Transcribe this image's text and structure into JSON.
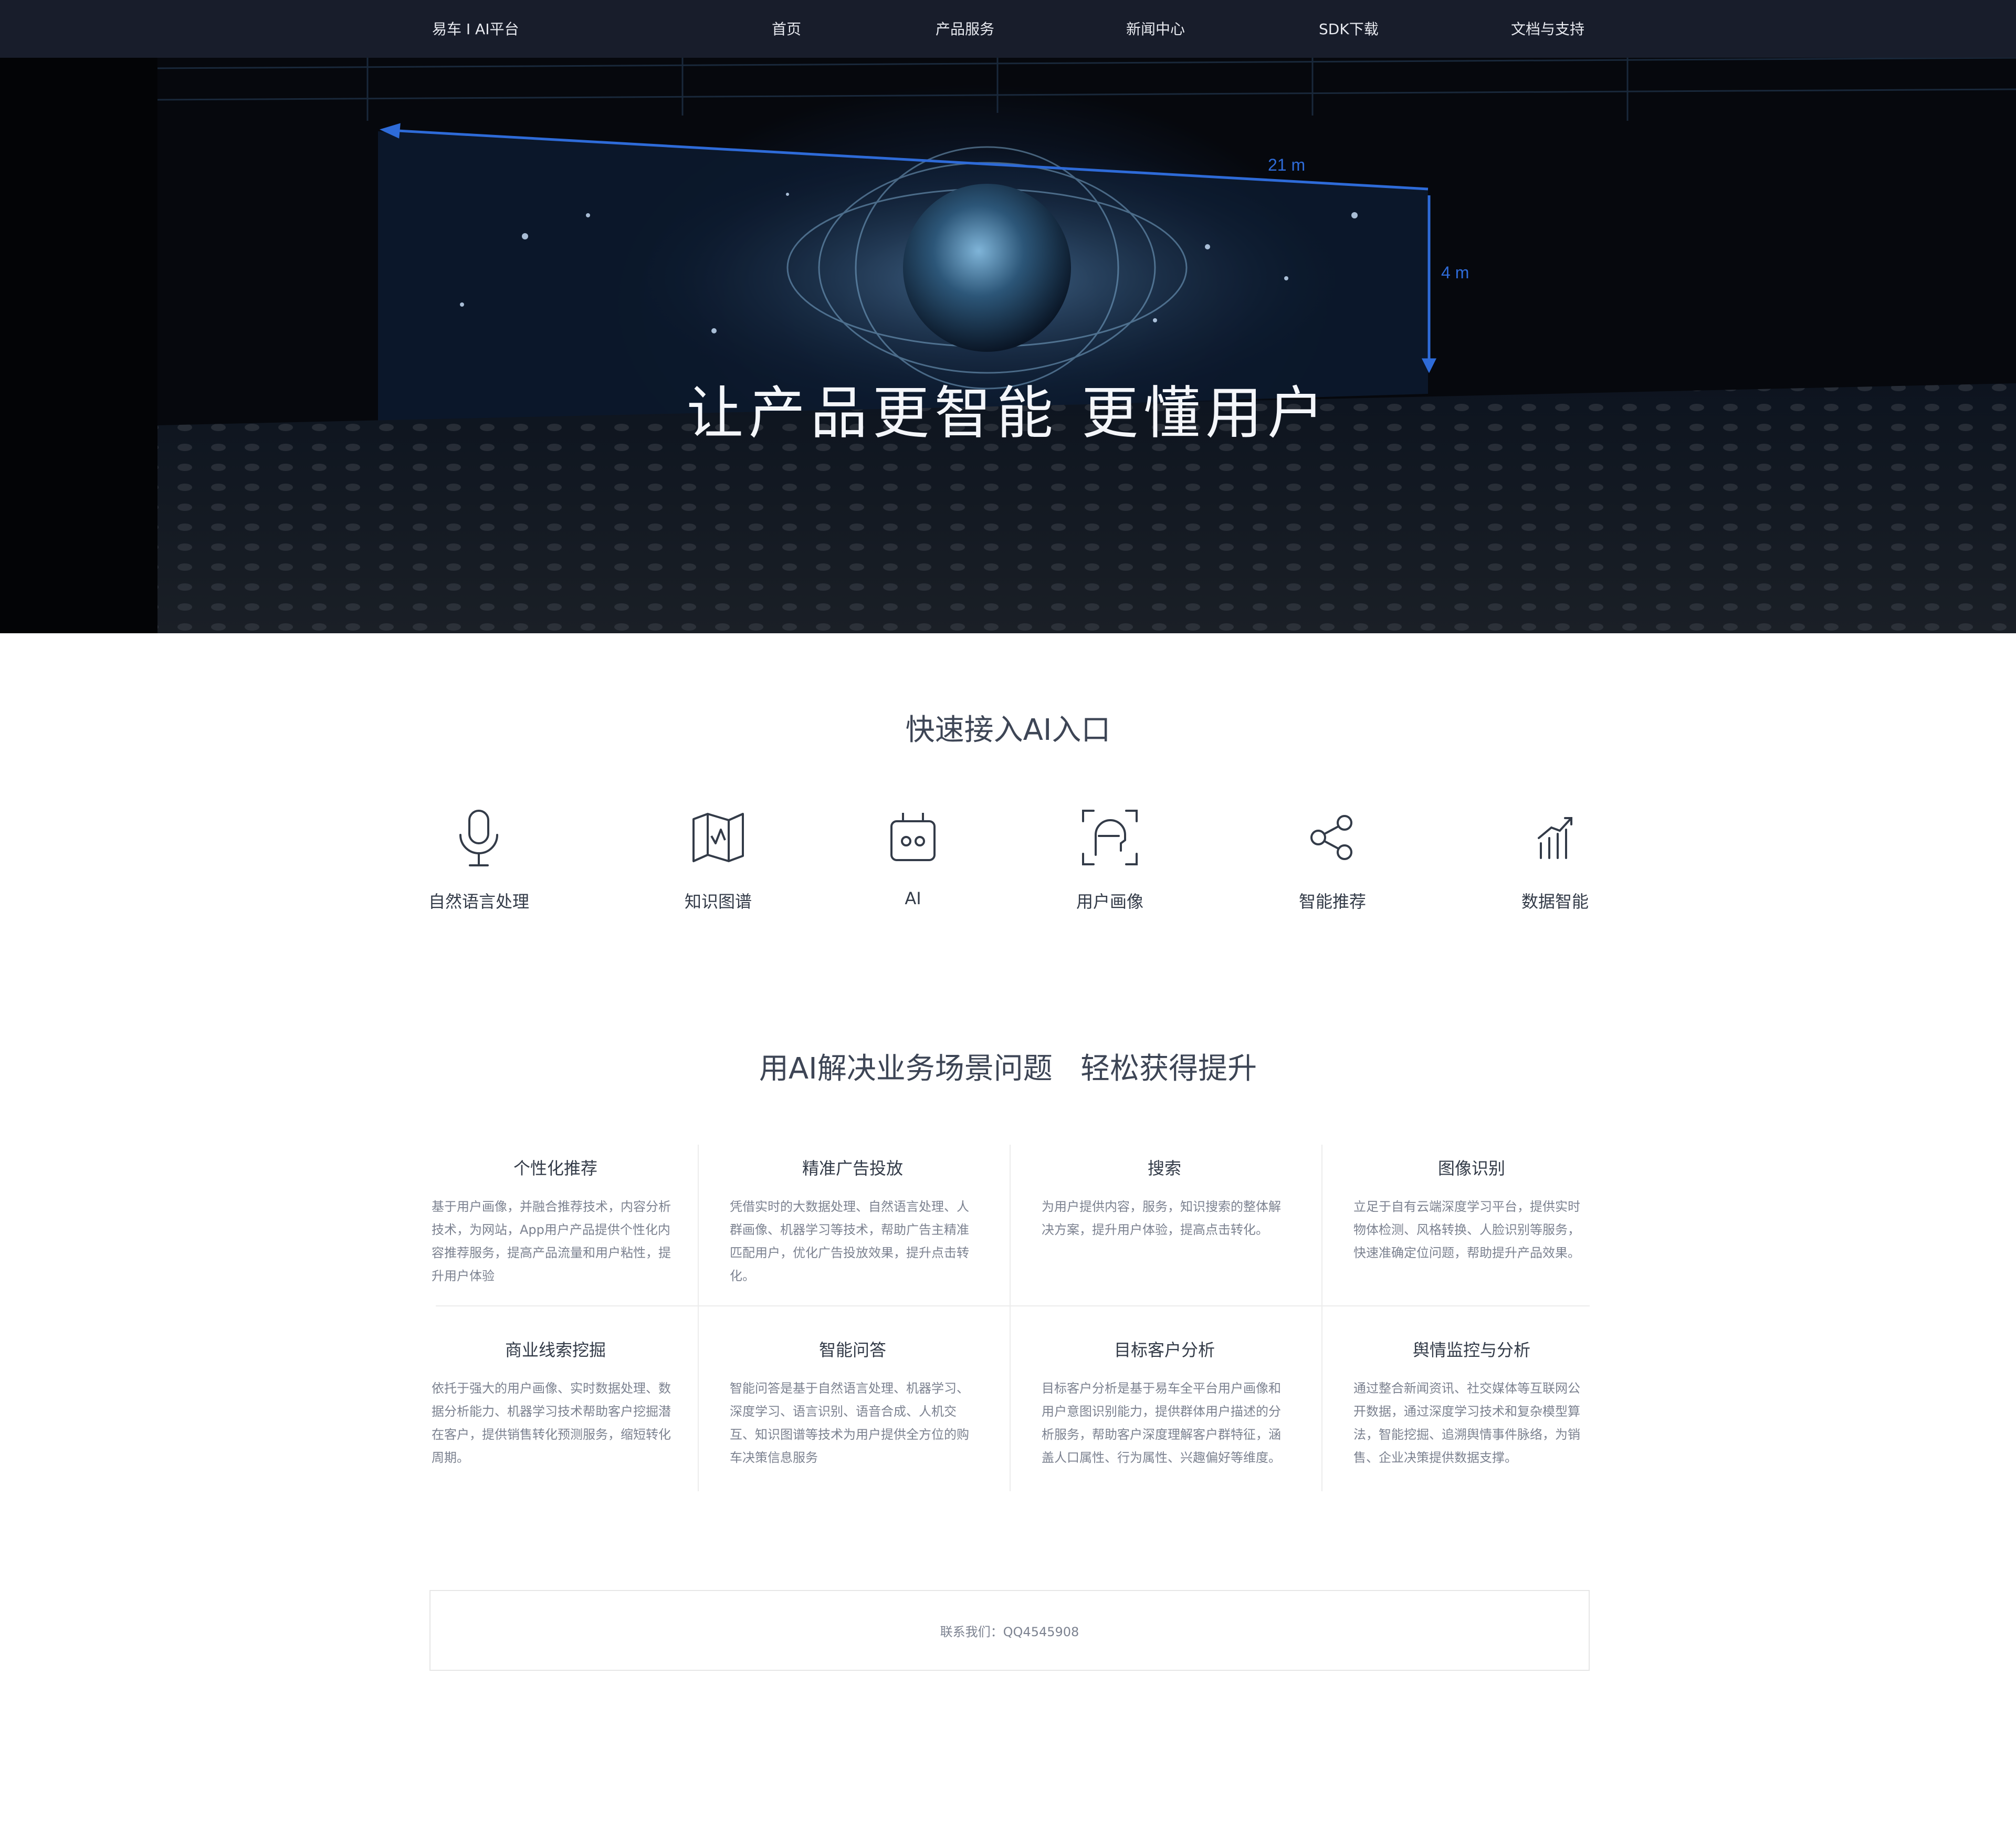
{
  "nav": {
    "brand": "易车 I AI平台",
    "items": [
      "首页",
      "产品服务",
      "新闻中心",
      "SDK下载",
      "文档与支持"
    ]
  },
  "hero": {
    "title": "让产品更智能 更懂用户",
    "width_label": "21 m",
    "height_label": "4 m"
  },
  "quick_access": {
    "title": "快速接入AI入口",
    "items": [
      {
        "label": "自然语言处理",
        "icon": "microphone-icon"
      },
      {
        "label": "知识图谱",
        "icon": "map-icon"
      },
      {
        "label": "AI",
        "icon": "robot-icon"
      },
      {
        "label": "用户画像",
        "icon": "face-scan-icon"
      },
      {
        "label": "智能推荐",
        "icon": "share-icon"
      },
      {
        "label": "数据智能",
        "icon": "chart-trend-icon"
      }
    ]
  },
  "scenarios": {
    "title": "用AI解决业务场景问题   轻松获得提升",
    "items": [
      {
        "title": "个性化推荐",
        "desc": "基于用户画像，并融合推荐技术，内容分析技术，为网站，App用户产品提供个性化内容推荐服务，提高产品流量和用户粘性，提升用户体验"
      },
      {
        "title": "精准广告投放",
        "desc": "凭借实时的大数据处理、自然语言处理、人群画像、机器学习等技术，帮助广告主精准匹配用户，优化广告投放效果，提升点击转化。"
      },
      {
        "title": "搜索",
        "desc": "为用户提供内容，服务，知识搜索的整体解决方案，提升用户体验，提高点击转化。"
      },
      {
        "title": "图像识别",
        "desc": "立足于自有云端深度学习平台，提供实时物体检测、风格转换、人脸识别等服务，快速准确定位问题，帮助提升产品效果。"
      },
      {
        "title": "商业线索挖掘",
        "desc": "依托于强大的用户画像、实时数据处理、数据分析能力、机器学习技术帮助客户挖掘潜在客户，提供销售转化预测服务，缩短转化周期。"
      },
      {
        "title": "智能问答",
        "desc": "智能问答是基于自然语言处理、机器学习、深度学习、语言识别、语音合成、人机交互、知识图谱等技术为用户提供全方位的购车决策信息服务"
      },
      {
        "title": "目标客户分析",
        "desc": "目标客户分析是基于易车全平台用户画像和用户意图识别能力，提供群体用户描述的分析服务，帮助客户深度理解客户群特征，涵盖人口属性、行为属性、兴趣偏好等维度。"
      },
      {
        "title": "舆情监控与分析",
        "desc": "通过整合新闻资讯、社交媒体等互联网公开数据，通过深度学习技术和复杂模型算法，智能挖掘、追溯舆情事件脉络，为销售、企业决策提供数据支撑。"
      }
    ]
  },
  "footer": {
    "contact": "联系我们：QQ4545908"
  }
}
